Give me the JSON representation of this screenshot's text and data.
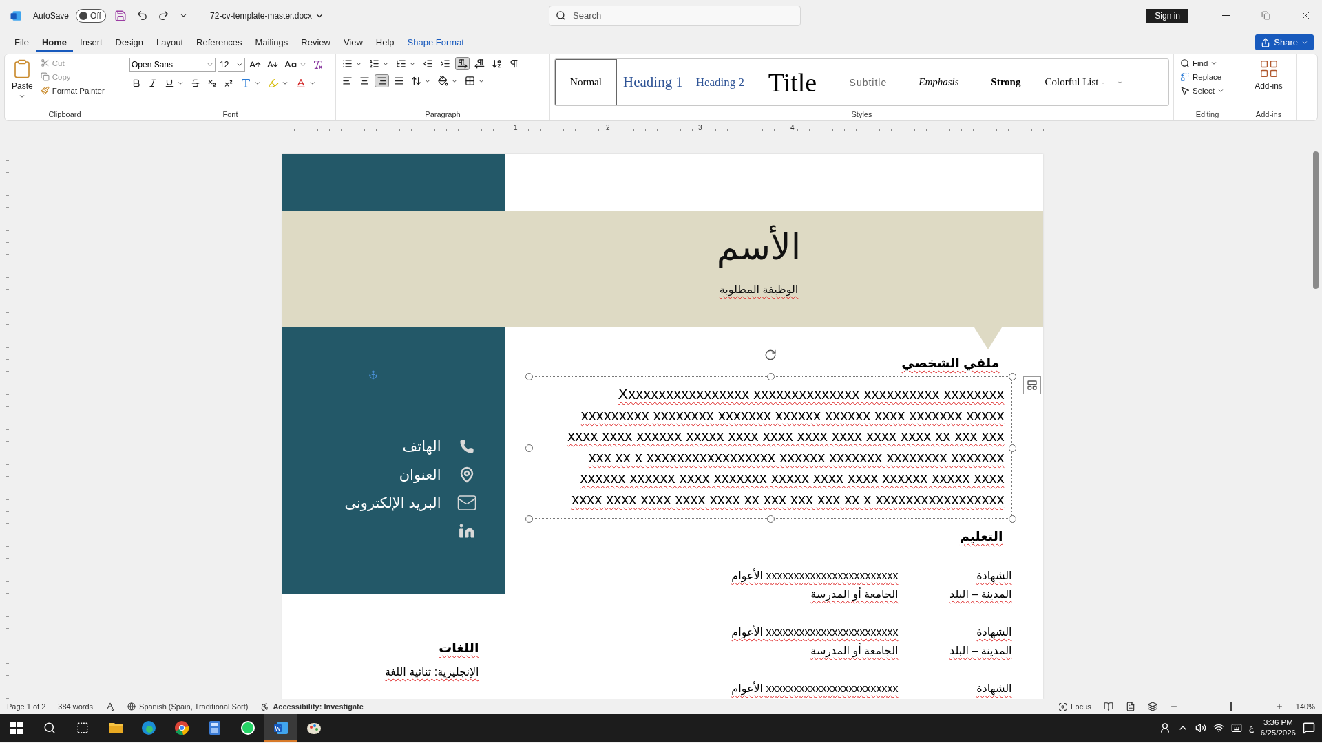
{
  "title_bar": {
    "autosave_label": "AutoSave",
    "autosave": {
      "on": false,
      "label": "Off"
    },
    "file_name": "72-cv-template-master.docx",
    "search": {
      "placeholder": "Search"
    },
    "sign_in": "Sign in"
  },
  "tabs": [
    {
      "label": "File",
      "selected": false,
      "kind": "normal"
    },
    {
      "label": "Home",
      "selected": true,
      "kind": "normal"
    },
    {
      "label": "Insert",
      "selected": false,
      "kind": "normal"
    },
    {
      "label": "Design",
      "selected": false,
      "kind": "normal"
    },
    {
      "label": "Layout",
      "selected": false,
      "kind": "normal"
    },
    {
      "label": "References",
      "selected": false,
      "kind": "normal"
    },
    {
      "label": "Mailings",
      "selected": false,
      "kind": "normal"
    },
    {
      "label": "Review",
      "selected": false,
      "kind": "normal"
    },
    {
      "label": "View",
      "selected": false,
      "kind": "normal"
    },
    {
      "label": "Help",
      "selected": false,
      "kind": "normal"
    },
    {
      "label": "Shape Format",
      "selected": false,
      "kind": "contextual"
    }
  ],
  "share": "Share",
  "ribbon": {
    "clipboard": {
      "paste": "Paste",
      "cut": "Cut",
      "copy": "Copy",
      "format_painter": "Format Painter",
      "label": "Clipboard"
    },
    "font": {
      "name": "Open Sans",
      "size": "12",
      "label": "Font"
    },
    "paragraph": {
      "label": "Paragraph",
      "directions": [
        {
          "kind": "ltr",
          "selected": true
        },
        {
          "kind": "rtl",
          "selected": false
        }
      ],
      "alignments": [
        {
          "kind": "left",
          "selected": false
        },
        {
          "kind": "center",
          "selected": false
        },
        {
          "kind": "right",
          "selected": true
        },
        {
          "kind": "justify",
          "selected": false
        }
      ]
    },
    "styles": {
      "label": "Styles",
      "items": [
        {
          "label": "Normal",
          "kind": "normal",
          "selected": true
        },
        {
          "label": "Heading 1",
          "kind": "heading1",
          "selected": false
        },
        {
          "label": "Heading 2",
          "kind": "heading2",
          "selected": false
        },
        {
          "label": "Title",
          "kind": "title",
          "selected": false
        },
        {
          "label": "Subtitle",
          "kind": "subtitle",
          "selected": false
        },
        {
          "label": "Emphasis",
          "kind": "emphasis",
          "selected": false
        },
        {
          "label": "Strong",
          "kind": "strong",
          "selected": false
        },
        {
          "label": "Colorful List -",
          "kind": "plain",
          "selected": false
        }
      ]
    },
    "editing": {
      "label": "Editing",
      "find": "Find",
      "replace": "Replace",
      "select": "Select"
    },
    "addins": {
      "button": "Add-ins",
      "label": "Add-ins"
    }
  },
  "ruler": {
    "numbers": [
      "1",
      "2",
      "3",
      "4"
    ]
  },
  "document": {
    "name": "الأسم",
    "job_title": "الوظيفة المطلوبة",
    "contacts": [
      {
        "kind": "phone",
        "label": "الهاتف"
      },
      {
        "kind": "location",
        "label": "العنوان"
      },
      {
        "kind": "email",
        "label": "البريد الإلكترونى"
      },
      {
        "kind": "linkedin"
      }
    ],
    "profile": {
      "heading": "ملفي الشخصي",
      "selected": true,
      "lines": [
        "Xxxxxxxxxxxxxxxxx xxxxxxxxxxxxxx xxxxxxxxxx xxxxxxxx",
        "xxxxxxxxx xxxxxxxx xxxxxxx xxxxxx xxxxxx xxxx xxxxxxx xxxxx",
        "xxxx xxxx xxxxxx xxxxx xxxx xxxx xxxx xxxx xxxx xxxx xx xxx xxx",
        "xxx xx x xxxxxxxxxxxxxxxxx xxxxxx xxxxxxx xxxxxxxx xxxxxxx",
        "xxxxxx xxxxxx xxxx xxxxxxx xxxxx xxxx xxxx xxxxxx xxxxx xxxx",
        "xxxx xxxx xxxx xxxx xxxx xx xxx xxx xxx xx x xxxxxxxxxxxxxxxxx"
      ]
    },
    "education": {
      "heading": "التعليم",
      "entries": [
        {
          "degree": "الشهادة",
          "years": "xxxxxxxxxxxxxxxxxxxxxxxx الأعوام",
          "place": "المدينة – البلد",
          "school": "الجامعة أو المدرسة"
        },
        {
          "degree": "الشهادة",
          "years": "xxxxxxxxxxxxxxxxxxxxxxxx الأعوام",
          "place": "المدينة – البلد",
          "school": "الجامعة أو المدرسة"
        },
        {
          "degree": "الشهادة",
          "years": "xxxxxxxxxxxxxxxxxxxxxxxx الأعوام"
        }
      ]
    },
    "languages": {
      "heading": "اللغات",
      "items": [
        "الإنجليزية: ثنائية اللغة"
      ]
    }
  },
  "status_bar": {
    "page": "Page 1 of 2",
    "words": "384 words",
    "language": "Spanish (Spain, Traditional Sort)",
    "accessibility": "Accessibility: Investigate",
    "focus": "Focus",
    "zoom": "140%",
    "level": 0.55
  },
  "taskbar": {
    "apps": [
      {
        "kind": "explorer",
        "active": false
      },
      {
        "kind": "edge",
        "active": false
      },
      {
        "kind": "chrome",
        "active": false
      },
      {
        "kind": "calculator",
        "active": false
      },
      {
        "kind": "whatsapp",
        "active": false
      },
      {
        "kind": "word",
        "active": true
      },
      {
        "kind": "paint",
        "active": false
      }
    ],
    "ime": "ع",
    "time": "3:36 PM",
    "date": "6/25/2026"
  }
}
